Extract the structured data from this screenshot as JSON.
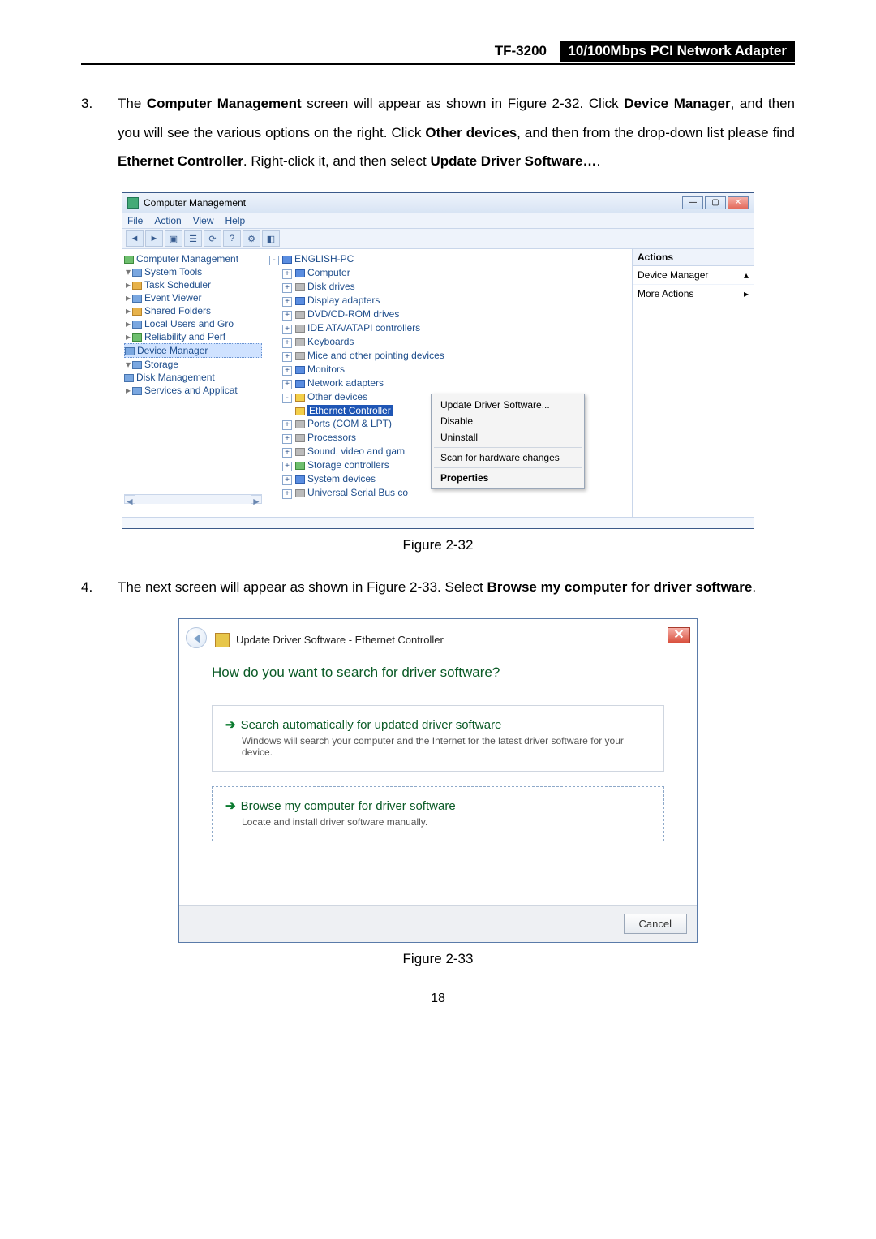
{
  "header": {
    "model": "TF-3200",
    "title": "10/100Mbps PCI Network Adapter"
  },
  "step3": {
    "num": "3.",
    "p1a": "The ",
    "b1": "Computer Management",
    "p1b": " screen will appear as shown in Figure 2-32. Click ",
    "b2": "Device Manager",
    "p1c": ", and then you will see the various options on the right. Click ",
    "b3": "Other devices",
    "p1d": ", and then from the drop-down list please find ",
    "b4": "Ethernet Controller",
    "p1e": ". Right-click it, and then select ",
    "b5": "Update Driver Software…",
    "p1f": "."
  },
  "cm": {
    "title": "Computer Management",
    "menu": {
      "file": "File",
      "action": "Action",
      "view": "View",
      "help": "Help"
    },
    "left": {
      "root": "Computer Management",
      "systools": "System Tools",
      "task": "Task Scheduler",
      "event": "Event Viewer",
      "shared": "Shared Folders",
      "local": "Local Users and Gro",
      "reliab": "Reliability and Perf",
      "devmgr": "Device Manager",
      "storage": "Storage",
      "diskm": "Disk Management",
      "services": "Services and Applicat"
    },
    "dev": {
      "root": "ENGLISH-PC",
      "computer": "Computer",
      "disk": "Disk drives",
      "display": "Display adapters",
      "dvd": "DVD/CD-ROM drives",
      "ide": "IDE ATA/ATAPI controllers",
      "kb": "Keyboards",
      "mice": "Mice and other pointing devices",
      "mon": "Monitors",
      "net": "Network adapters",
      "other": "Other devices",
      "eth": "Ethernet Controller",
      "ports": "Ports (COM & LPT)",
      "proc": "Processors",
      "sound": "Sound, video and gam",
      "storc": "Storage controllers",
      "sysdev": "System devices",
      "usb": "Universal Serial Bus co"
    },
    "ctx": {
      "update": "Update Driver Software...",
      "disable": "Disable",
      "uninstall": "Uninstall",
      "scan": "Scan for hardware changes",
      "props": "Properties"
    },
    "actions": {
      "header": "Actions",
      "devmgr": "Device Manager",
      "more": "More Actions"
    }
  },
  "fig32": "Figure 2-32",
  "step4": {
    "num": "4.",
    "p1a": "The next screen will appear as shown in Figure 2-33. Select ",
    "b1": "Browse my computer for driver software",
    "p1b": "."
  },
  "wiz": {
    "title": "Update Driver Software - Ethernet Controller",
    "heading": "How do you want to search for driver software?",
    "opt1": {
      "title": "Search automatically for updated driver software",
      "desc": "Windows will search your computer and the Internet for the latest driver software for your device."
    },
    "opt2": {
      "title": "Browse my computer for driver software",
      "desc": "Locate and install driver software manually."
    },
    "cancel": "Cancel"
  },
  "fig33": "Figure 2-33",
  "pagenum": "18"
}
